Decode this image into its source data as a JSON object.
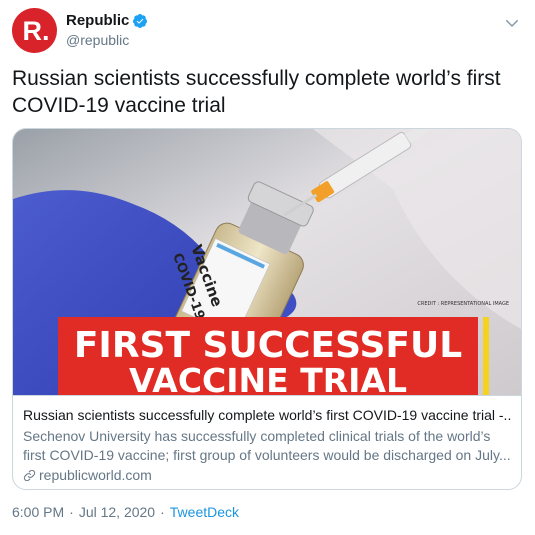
{
  "account": {
    "name": "Republic",
    "handle": "@republic",
    "avatar_letter": "R.",
    "verified": true
  },
  "tweet": {
    "text": "Russian scientists successfully complete world’s first COVID-19 vaccine trial"
  },
  "card": {
    "image_banner_line1": "FIRST SUCCESSFUL",
    "image_banner_line2": "VACCINE TRIAL",
    "image_credit": "CREDIT : REPRESENTATIONAL IMAGE",
    "vial_label_line1": "Vaccine",
    "vial_label_line2": "COVID-19",
    "title": "Russian scientists successfully complete world’s first COVID-19 vaccine trial -...",
    "description": "Sechenov University has successfully completed clinical trials of the world’s first COVID-19 vaccine; first group of volunteers would be discharged on July...",
    "domain": "republicworld.com"
  },
  "footer": {
    "time": "6:00 PM",
    "separator": "·",
    "date": "Jul 12, 2020",
    "source": "TweetDeck"
  },
  "colors": {
    "brand_red": "#d9232a",
    "verified_blue": "#1da1f2",
    "link_blue": "#1b95e0",
    "secondary_text": "#657786"
  },
  "icons": {
    "verified": "verified-badge-icon",
    "caret": "chevron-down-icon",
    "link": "link-icon"
  }
}
